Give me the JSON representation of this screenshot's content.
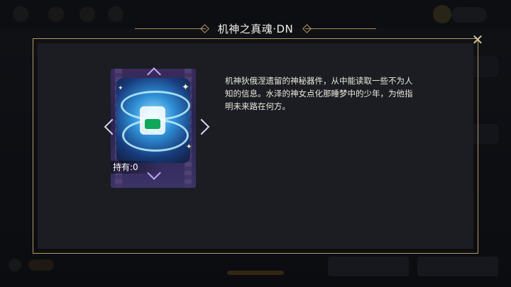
{
  "dialog": {
    "title": "机神之真魂·DN",
    "close_icon": "close-icon",
    "description": "机神狄俄涅遗留的神秘器件，从中能读取一些不为人知的信息。水泽的神女点化那睡梦中的少年，为他指明未来路在何方。",
    "owned_label": "持有:0",
    "item_image": "mech-soul-dn-card-art",
    "nav": {
      "prev_icon": "chevron-left-icon",
      "next_icon": "chevron-right-icon"
    }
  },
  "colors": {
    "frame_gold": "#b59a63",
    "panel_bg": "#1c1e23",
    "card_purple": "#3a2b5c",
    "art_blue": "#2f8fd6"
  }
}
